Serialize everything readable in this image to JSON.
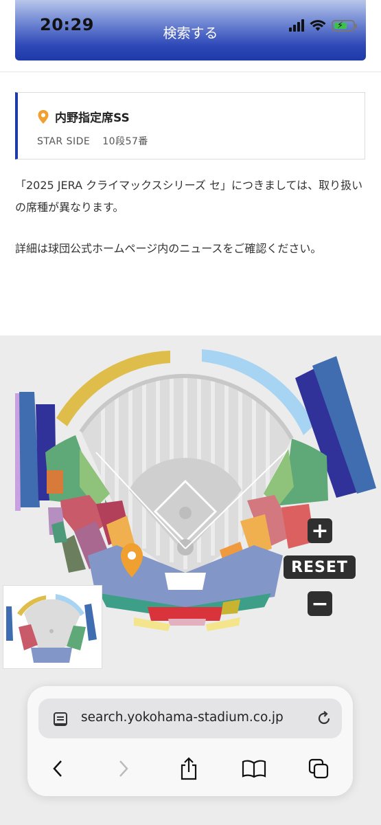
{
  "status": {
    "time": "20:29"
  },
  "header": {
    "search_label": "検索する"
  },
  "seat": {
    "name": "内野指定席SS",
    "side": "STAR SIDE",
    "position": "10段57番"
  },
  "notice": {
    "line1": "「2025 JERA クライマックスシリーズ セ」につきましては、取り扱いの席種が異なります。",
    "line2": "詳細は球団公式ホームページ内のニュースをご確認ください。"
  },
  "map_controls": {
    "zoom_in": "+",
    "reset": "RESET",
    "zoom_out": "−"
  },
  "browser": {
    "url": "search.yokohama-stadium.co.jp"
  },
  "icons": [
    "location-pin-icon",
    "signal-icon",
    "wifi-icon",
    "battery-icon",
    "page-icon",
    "reload-icon",
    "back-icon",
    "forward-icon",
    "share-icon",
    "bookmarks-icon",
    "tabs-icon"
  ],
  "colors": {
    "header_blue": "#1d3aa8",
    "pin_orange": "#f0a030"
  }
}
